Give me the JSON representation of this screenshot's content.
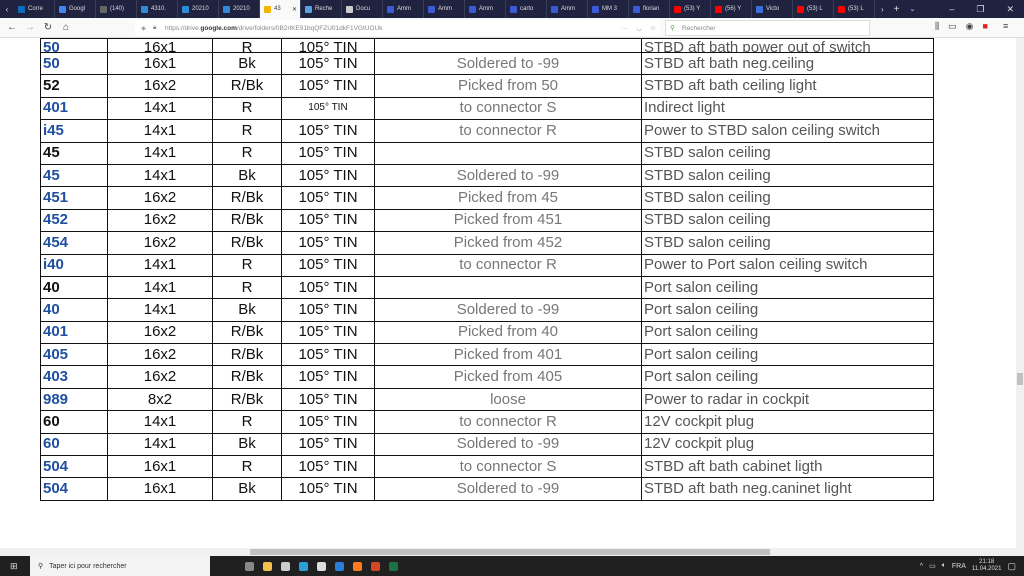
{
  "browser": {
    "tabs": [
      {
        "label": "Corre",
        "color": "#0f6cbd"
      },
      {
        "label": "Googl",
        "color": "#4285f4"
      },
      {
        "label": "(140)",
        "color": "#666666"
      },
      {
        "label": "4310.",
        "color": "#2e8bd8"
      },
      {
        "label": "20210",
        "color": "#2e8bd8"
      },
      {
        "label": "20210",
        "color": "#2e8bd8"
      },
      {
        "label": "43",
        "color": "#f4b400",
        "active": true
      },
      {
        "label": "Reche",
        "color": "#5aa0e0"
      },
      {
        "label": "Docu",
        "color": "#cccccc"
      },
      {
        "label": "Amm",
        "color": "#3b5bd6"
      },
      {
        "label": "Amm",
        "color": "#3b5bd6"
      },
      {
        "label": "Amm",
        "color": "#3b5bd6"
      },
      {
        "label": "carto",
        "color": "#3b5bd6"
      },
      {
        "label": "Amm",
        "color": "#3b5bd6"
      },
      {
        "label": "MM 3",
        "color": "#3b5bd6"
      },
      {
        "label": "florian",
        "color": "#3b5bd6"
      },
      {
        "label": "(53) Y",
        "color": "#ff0000"
      },
      {
        "label": "(56) Y",
        "color": "#ff0000"
      },
      {
        "label": "Victo",
        "color": "#3a6fd8"
      },
      {
        "label": "(53) L",
        "color": "#ff0000"
      },
      {
        "label": "(53) L",
        "color": "#ff0000"
      }
    ],
    "url_prefix": "https://drive.",
    "url_domain": "google.com",
    "url_path": "/drive/folders/0B2rlKE91bqQFZU01dkF1VGtUOUk",
    "search_placeholder": "Rechercher"
  },
  "table": {
    "rows": [
      {
        "id": "50",
        "blue": true,
        "gauge": "16x1",
        "color": "R",
        "type": "105° TIN",
        "note": "",
        "desc": "STBD aft bath power out of switch"
      },
      {
        "id": "50",
        "blue": true,
        "gauge": "16x1",
        "color": "Bk",
        "type": "105° TIN",
        "note": "Soldered to -99",
        "desc": "STBD aft bath neg.ceiling"
      },
      {
        "id": "52",
        "blue": false,
        "gauge": "16x2",
        "color": "R/Bk",
        "type": "105° TIN",
        "note": "Picked from 50",
        "desc": "STBD aft bath ceiling light"
      },
      {
        "id": "401",
        "blue": true,
        "gauge": "14x1",
        "color": "R",
        "type": "105° TIN",
        "note": "to connector S",
        "desc": "Indirect light",
        "small": true
      },
      {
        "id": "i45",
        "blue": true,
        "gauge": "14x1",
        "color": "R",
        "type": "105° TIN",
        "note": "to connector R",
        "desc": "Power to STBD salon  ceiling switch"
      },
      {
        "id": "45",
        "blue": false,
        "gauge": "14x1",
        "color": "R",
        "type": "105° TIN",
        "note": "",
        "desc": "STBD salon ceiling"
      },
      {
        "id": "45",
        "blue": true,
        "gauge": "14x1",
        "color": "Bk",
        "type": "105° TIN",
        "note": "Soldered to -99",
        "desc": "STBD salon ceiling"
      },
      {
        "id": "451",
        "blue": true,
        "gauge": "16x2",
        "color": "R/Bk",
        "type": "105° TIN",
        "note": "Picked from 45",
        "desc": "STBD salon ceiling"
      },
      {
        "id": "452",
        "blue": true,
        "gauge": "16x2",
        "color": "R/Bk",
        "type": "105° TIN",
        "note": "Picked from 451",
        "desc": "STBD salon ceiling"
      },
      {
        "id": "454",
        "blue": true,
        "gauge": "16x2",
        "color": "R/Bk",
        "type": "105° TIN",
        "note": "Picked from 452",
        "desc": "STBD salon ceiling"
      },
      {
        "id": "i40",
        "blue": true,
        "gauge": "14x1",
        "color": "R",
        "type": "105° TIN",
        "note": "to connector R",
        "desc": "Power to Port salon ceiling switch"
      },
      {
        "id": "40",
        "blue": false,
        "gauge": "14x1",
        "color": "R",
        "type": "105° TIN",
        "note": "",
        "desc": "Port salon ceiling"
      },
      {
        "id": "40",
        "blue": true,
        "gauge": "14x1",
        "color": "Bk",
        "type": "105° TIN",
        "note": "Soldered to -99",
        "desc": "Port salon ceiling"
      },
      {
        "id": "401",
        "blue": true,
        "gauge": "16x2",
        "color": "R/Bk",
        "type": "105° TIN",
        "note": "Picked from 40",
        "desc": "Port salon ceiling"
      },
      {
        "id": "405",
        "blue": true,
        "gauge": "16x2",
        "color": "R/Bk",
        "type": "105° TIN",
        "note": "Picked from 401",
        "desc": "Port salon ceiling"
      },
      {
        "id": "403",
        "blue": true,
        "gauge": "16x2",
        "color": "R/Bk",
        "type": "105° TIN",
        "note": "Picked from 405",
        "desc": "Port salon ceiling"
      },
      {
        "id": "989",
        "blue": true,
        "gauge": "8x2",
        "color": "R/Bk",
        "type": "105° TIN",
        "note": "loose",
        "desc": "Power to radar in cockpit"
      },
      {
        "id": "60",
        "blue": false,
        "gauge": "14x1",
        "color": "R",
        "type": "105° TIN",
        "note": "to connector R",
        "desc": "12V cockpit plug"
      },
      {
        "id": "60",
        "blue": true,
        "gauge": "14x1",
        "color": "Bk",
        "type": "105° TIN",
        "note": "Soldered to -99",
        "desc": "12V cockpit plug"
      },
      {
        "id": "504",
        "blue": true,
        "gauge": "16x1",
        "color": "R",
        "type": "105° TIN",
        "note": "to connector S",
        "desc": "STBD aft bath cabinet ligth"
      },
      {
        "id": "504",
        "blue": true,
        "gauge": "16x1",
        "color": "Bk",
        "type": "105° TIN",
        "note": "Soldered to -99",
        "desc": "STBD aft bath neg.caninet light"
      }
    ]
  },
  "taskbar": {
    "search_placeholder": "Taper ici pour rechercher",
    "apps": [
      {
        "name": "task-view",
        "color": "#888888"
      },
      {
        "name": "file-explorer",
        "color": "#f2c14e"
      },
      {
        "name": "store",
        "color": "#cccccc"
      },
      {
        "name": "edge",
        "color": "#2aa0d8"
      },
      {
        "name": "dropbox",
        "color": "#dddddd"
      },
      {
        "name": "mail",
        "color": "#2a7ed8"
      },
      {
        "name": "firefox",
        "color": "#ff7b1c"
      },
      {
        "name": "powerpoint",
        "color": "#d24726"
      },
      {
        "name": "excel",
        "color": "#1e7145"
      }
    ],
    "language": "FRA",
    "time": "21:18",
    "date": "11.04.2021"
  }
}
